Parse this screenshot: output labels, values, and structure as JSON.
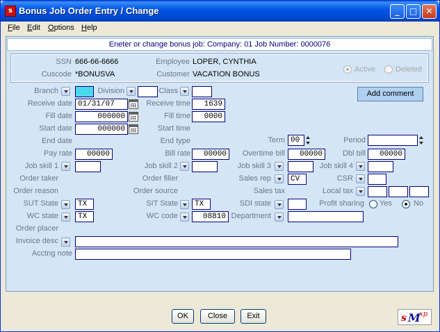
{
  "window": {
    "title": "Bonus Job Order Entry / Change",
    "icon": "app-logo-icon"
  },
  "menu": {
    "file": "File",
    "edit": "Edit",
    "options": "Options",
    "help": "Help"
  },
  "header": {
    "text": "Eneter or change bonus job:  Company:  01   Job Number:  0000076"
  },
  "info": {
    "ssn_label": "SSN",
    "ssn": "666-66-6666",
    "cuscode_label": "Cuscode",
    "cuscode": "*BONUSVA",
    "employee_label": "Employee",
    "employee": "LOPER, CYNTHIA",
    "customer_label": "Customer",
    "customer": "VACATION BONUS",
    "active_label": "Active",
    "deleted_label": "Deleted"
  },
  "buttons": {
    "add_comment": "Add comment",
    "ok": "OK",
    "close": "Close",
    "exit": "Exit"
  },
  "labels": {
    "branch": "Branch",
    "division": "Division",
    "class": "Class",
    "receive_date": "Receive date",
    "receive_time": "Receive time",
    "fill_date": "Fill date",
    "fill_time": "Fill time",
    "start_date": "Start date",
    "start_time": "Start time",
    "end_date": "End date",
    "end_type": "End type",
    "term": "Term",
    "period": "Period",
    "pay_rate": "Pay rate",
    "bill_rate": "Bill rate",
    "overtime_bill": "Overtime bill",
    "dbl_bill": "Dbl bill",
    "job_skill_1": "Job skill 1",
    "job_skill_2": "Job skill 2",
    "job_skill_3": "Job skill 3",
    "job_skill_4": "Job skill 4",
    "order_taker": "Order taker",
    "order_filler": "Order filler",
    "sales_rep": "Sales rep",
    "csr": "CSR",
    "order_reason": "Order reason",
    "order_source": "Order source",
    "sales_tax": "Sales tax",
    "local_tax": "Local tax",
    "sut_state": "SUT State",
    "sit_state": "SIT State",
    "sdi_state": "SDI state",
    "profit_sharing": "Profit sharing",
    "yes": "Yes",
    "no": "No",
    "wc_state": "WC state",
    "wc_code": "WC code",
    "department": "Department",
    "order_placer": "Order placer",
    "invoice_desc": "Invoice desc",
    "acctng_note": "Acctng note"
  },
  "values": {
    "receive_date": "01/31/07",
    "receive_time": "1639",
    "fill_date": "000000",
    "fill_time": "0000",
    "start_date": "000000",
    "term": "00",
    "pay_rate": "00000",
    "bill_rate": "00000",
    "overtime_bill": "00000",
    "dbl_bill": "00000",
    "sales_rep": "CV",
    "sut_state": "TX",
    "sit_state": "TX",
    "wc_state": "TX",
    "wc_code": "08810"
  },
  "logo": {
    "s": "s",
    "m": "M",
    "z": "z",
    "xp": "xp"
  },
  "colors": {
    "title_bar": "#0055e5",
    "panel": "#d4e5f5",
    "header_text": "#000080",
    "label": "#6a7888"
  }
}
